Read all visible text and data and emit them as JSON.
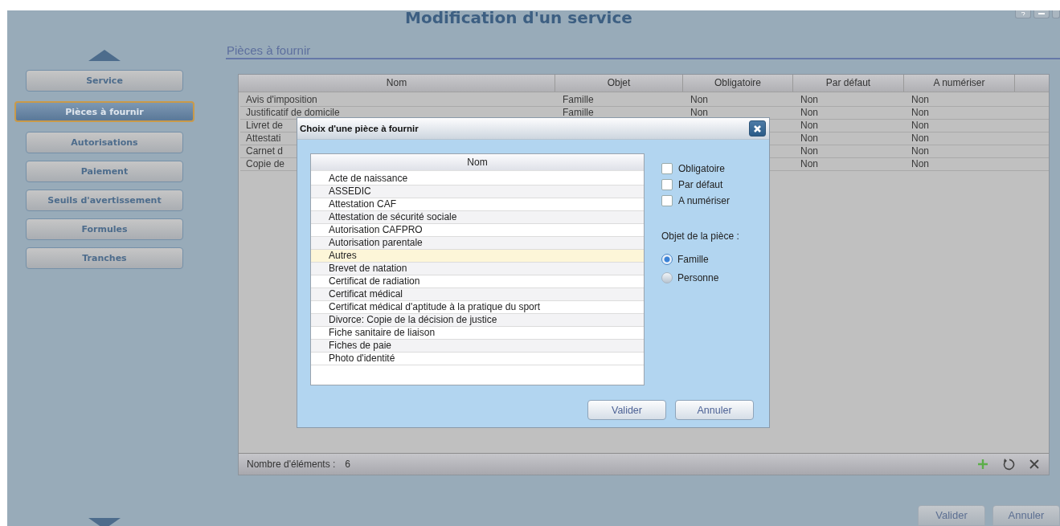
{
  "window": {
    "title": "Modification d'un service"
  },
  "nav": {
    "items": [
      {
        "label": "Service",
        "selected": false
      },
      {
        "label": "Pièces à fournir",
        "selected": true
      },
      {
        "label": "Autorisations",
        "selected": false
      },
      {
        "label": "Paiement",
        "selected": false
      },
      {
        "label": "Seuils d'avertissement",
        "selected": false
      },
      {
        "label": "Formules",
        "selected": false
      },
      {
        "label": "Tranches",
        "selected": false
      }
    ]
  },
  "section": {
    "title": "Pièces à fournir"
  },
  "table": {
    "columns": [
      "Nom",
      "Objet",
      "Obligatoire",
      "Par défaut",
      "A numériser"
    ],
    "rows": [
      {
        "cells": [
          "Avis d'imposition",
          "Famille",
          "Non",
          "Non",
          "Non"
        ]
      },
      {
        "cells": [
          "Justificatif de domicile",
          "Famille",
          "Non",
          "Non",
          "Non"
        ]
      },
      {
        "cells": [
          "Livret de",
          null,
          null,
          "Non",
          "Non"
        ]
      },
      {
        "cells": [
          "Attestati",
          null,
          null,
          "Non",
          "Non"
        ]
      },
      {
        "cells": [
          "Carnet d",
          null,
          null,
          "Non",
          "Non"
        ]
      },
      {
        "cells": [
          "Copie de",
          null,
          null,
          "Non",
          "Non"
        ]
      }
    ],
    "footer": {
      "count_label": "Nombre d'éléments :",
      "count": "6"
    }
  },
  "buttons": [
    "Valider",
    "Annuler"
  ],
  "dialog": {
    "title": "Choix d'une pièce à fournir",
    "list": {
      "column": "Nom",
      "items": [
        {
          "label": "Acte de naissance",
          "selected": false
        },
        {
          "label": "ASSEDIC",
          "selected": false
        },
        {
          "label": "Attestation CAF",
          "selected": false
        },
        {
          "label": "Attestation de sécurité sociale",
          "selected": false
        },
        {
          "label": "Autorisation CAFPRO",
          "selected": false
        },
        {
          "label": "Autorisation parentale",
          "selected": false
        },
        {
          "label": "Autres",
          "selected": true
        },
        {
          "label": "Brevet de natation",
          "selected": false
        },
        {
          "label": "Certificat de radiation",
          "selected": false
        },
        {
          "label": "Certificat médical",
          "selected": false
        },
        {
          "label": "Certificat médical d'aptitude à la pratique du sport",
          "selected": false
        },
        {
          "label": "Divorce: Copie de la décision de justice",
          "selected": false
        },
        {
          "label": "Fiche sanitaire de liaison",
          "selected": false
        },
        {
          "label": "Fiches de paie",
          "selected": false
        },
        {
          "label": "Photo d'identité",
          "selected": false
        }
      ]
    },
    "options": [
      {
        "label": "Obligatoire",
        "checked": false
      },
      {
        "label": "Par défaut",
        "checked": false
      },
      {
        "label": "A numériser",
        "checked": false
      }
    ],
    "object_group": {
      "label": "Objet de la pièce :",
      "choices": [
        {
          "label": "Famille",
          "selected": true
        },
        {
          "label": "Personne",
          "selected": false
        }
      ]
    },
    "buttons": [
      "Valider",
      "Annuler"
    ]
  }
}
